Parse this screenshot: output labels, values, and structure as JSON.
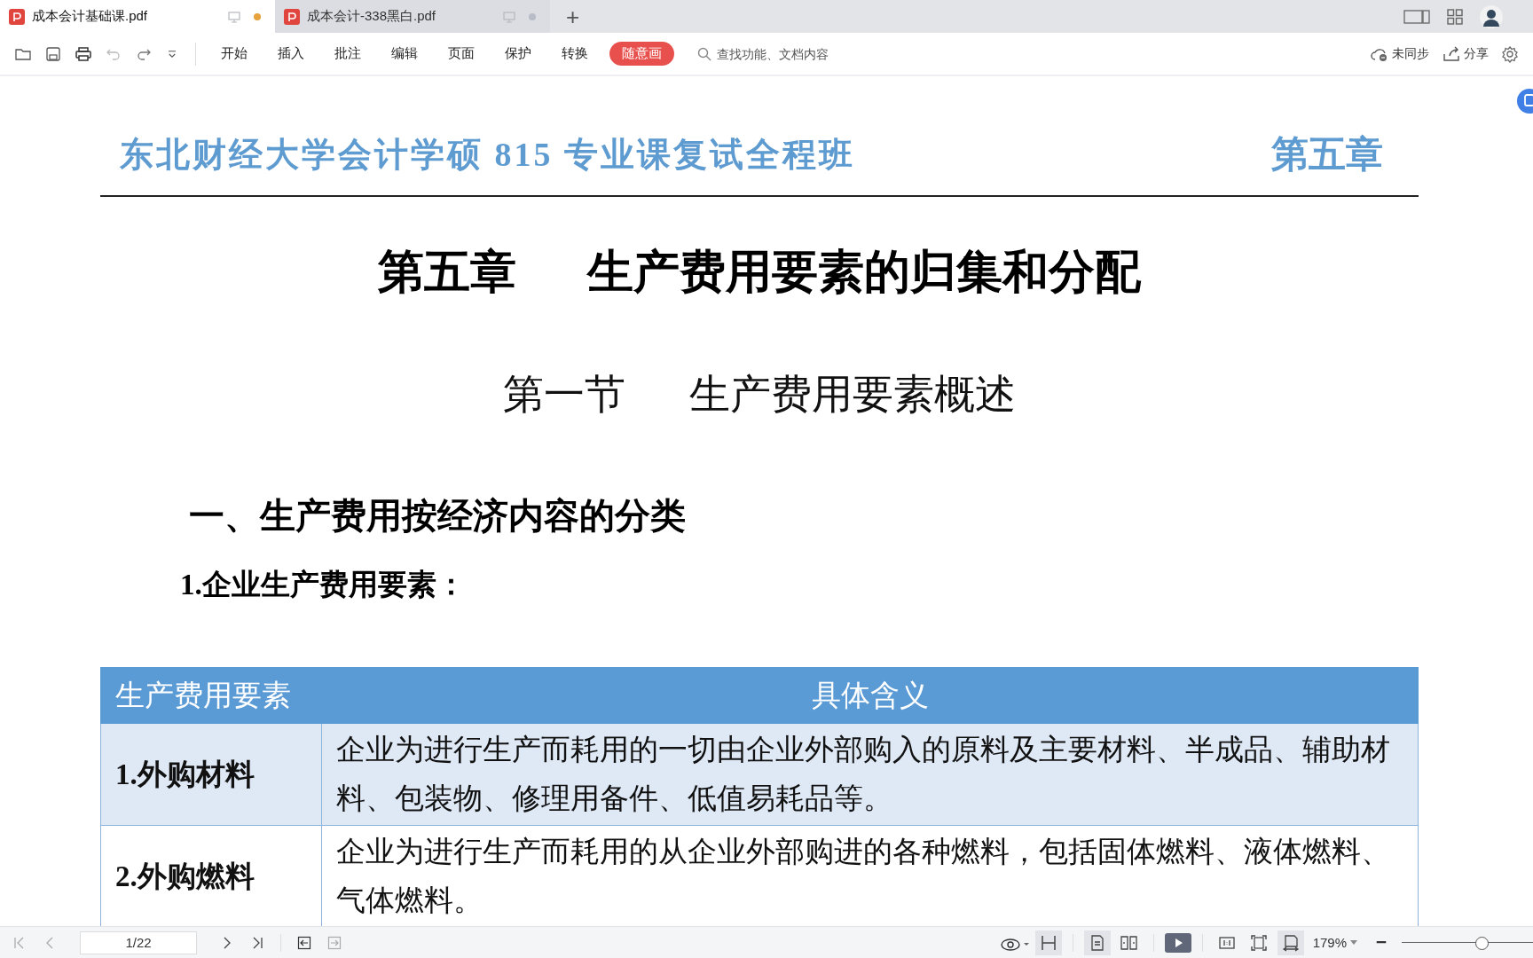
{
  "tabs": [
    {
      "label": "成本会计基础课.pdf",
      "selected": true,
      "modified": true
    },
    {
      "label": "成本会计-338黑白.pdf",
      "selected": false,
      "modified": false
    }
  ],
  "tab_bar": {
    "new_tab": "+"
  },
  "toolbar": {
    "menus": [
      "开始",
      "插入",
      "批注",
      "编辑",
      "页面",
      "保护",
      "转换"
    ],
    "draw_button": "随意画",
    "search": {
      "placeholder": "查找功能、文档内容"
    },
    "sync_status": "未同步",
    "share": "分享"
  },
  "document": {
    "running_header": "东北财经大学会计学硕 815 专业课复试全程班",
    "header_chapter": "第五章",
    "chapter_label": "第五章",
    "chapter_title": "生产费用要素的归集和分配",
    "section_label": "第一节",
    "section_title": "生产费用要素概述",
    "heading": "一、生产费用按经济内容的分类",
    "subheading": "1.企业生产费用要素：",
    "table": {
      "columns": [
        "生产费用要素",
        "具体含义"
      ],
      "rows": [
        {
          "element": "1.外购材料",
          "meaning": "企业为进行生产而耗用的一切由企业外部购入的原料及主要材料、半成品、辅助材料、包装物、修理用备件、低值易耗品等。"
        },
        {
          "element": "2.外购燃料",
          "meaning": "企业为进行生产而耗用的从企业外部购进的各种燃料，包括固体燃料、液体燃料、气体燃料。"
        }
      ]
    }
  },
  "status_bar": {
    "page": "1/22",
    "continuous_selected": true,
    "view_buttons": [
      {
        "kind": "single",
        "selected": true
      },
      {
        "kind": "double",
        "selected": false
      }
    ],
    "fit_buttons": [
      {
        "kind": "actual",
        "selected": false
      },
      {
        "kind": "page",
        "selected": false
      },
      {
        "kind": "width",
        "selected": true
      }
    ],
    "zoom": "179%",
    "zoom_slider": {
      "level": 0.6
    }
  }
}
